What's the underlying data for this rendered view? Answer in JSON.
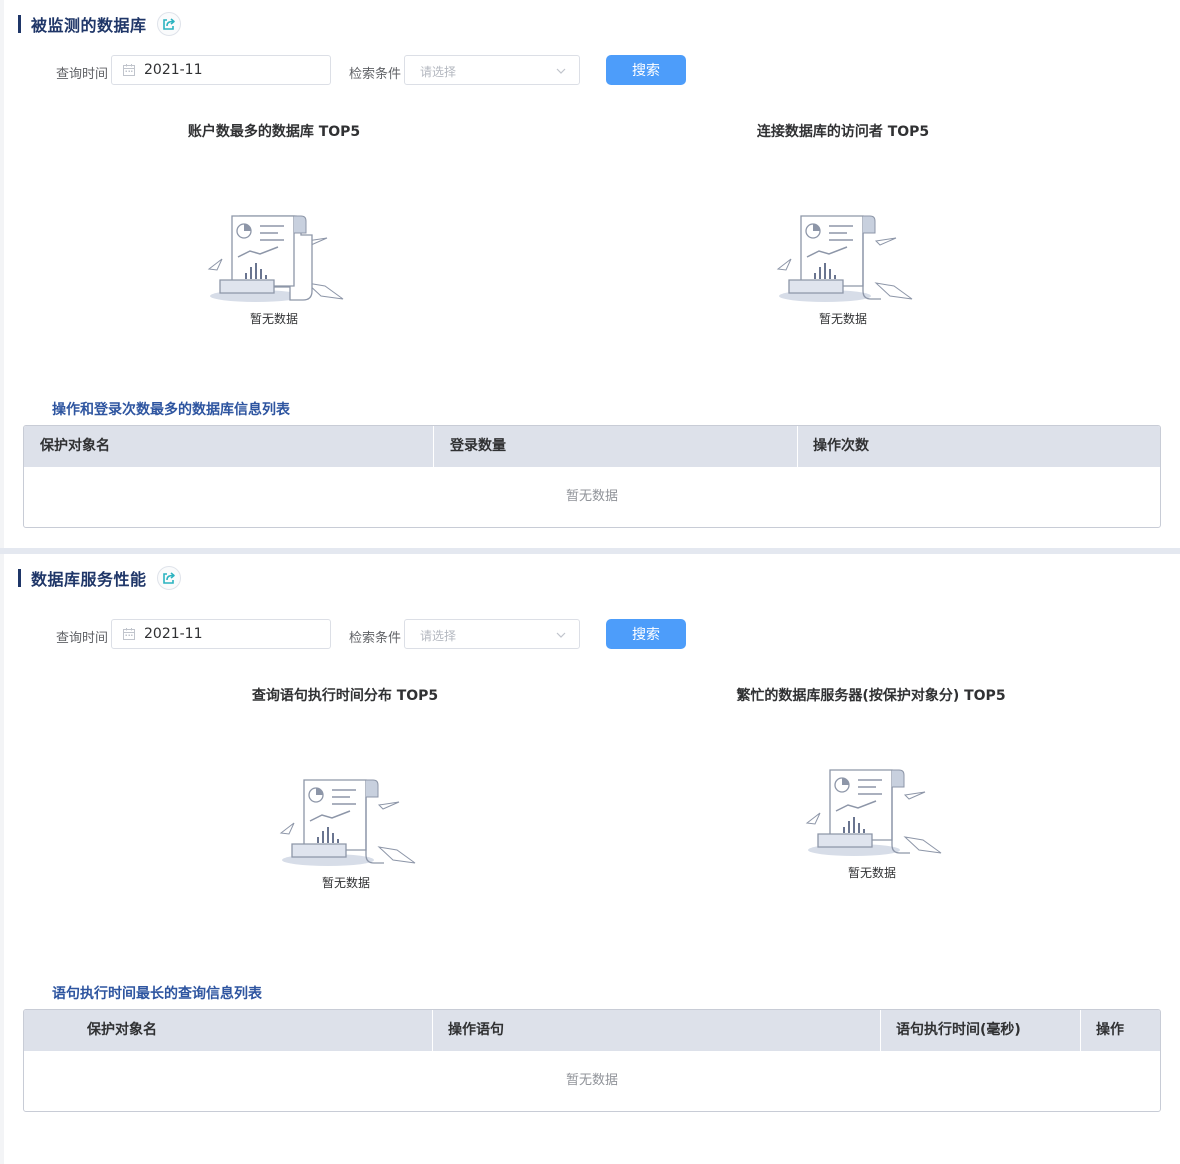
{
  "section1": {
    "title": "被监测的数据库",
    "form": {
      "date_label": "查询时间",
      "date_value": "2021-11",
      "cond_label": "检索条件",
      "cond_placeholder": "请选择",
      "search_label": "搜索"
    },
    "charts": [
      {
        "title": "账户数最多的数据库 TOP5",
        "empty_text": "暂无数据"
      },
      {
        "title": "连接数据库的访问者 TOP5",
        "empty_text": "暂无数据"
      }
    ],
    "table": {
      "title": "操作和登录次数最多的数据库信息列表",
      "columns": [
        "保护对象名",
        "登录数量",
        "操作次数"
      ],
      "rows": [],
      "empty_text": "暂无数据"
    }
  },
  "section2": {
    "title": "数据库服务性能",
    "form": {
      "date_label": "查询时间",
      "date_value": "2021-11",
      "cond_label": "检索条件",
      "cond_placeholder": "请选择",
      "search_label": "搜索"
    },
    "charts": [
      {
        "title": "查询语句执行时间分布 TOP5",
        "empty_text": "暂无数据"
      },
      {
        "title": "繁忙的数据库服务器(按保护对象分) TOP5",
        "empty_text": "暂无数据"
      }
    ],
    "table": {
      "title": "语句执行时间最长的查询信息列表",
      "columns": [
        "保护对象名",
        "操作语句",
        "语句执行时间(毫秒)",
        "操作"
      ],
      "rows": [],
      "empty_text": "暂无数据"
    }
  },
  "icons": {
    "export": "export-share-icon",
    "calendar": "calendar-icon",
    "dropdown": "chevron-down-icon",
    "empty": "empty-document-chart-icon"
  },
  "colors": {
    "section_title": "#1f3668",
    "table_title": "#2e55a0",
    "button": "#4d9dfa",
    "table_header": "#dde1ea",
    "export_icon": "#2bb3c0"
  }
}
